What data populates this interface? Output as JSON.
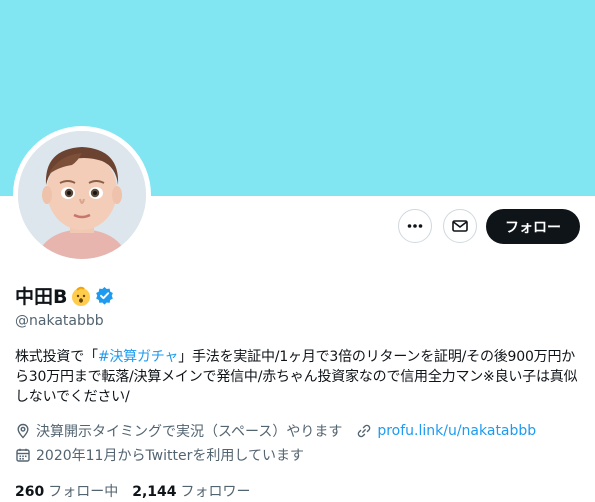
{
  "profile": {
    "display_name": "中田B",
    "handle": "@nakatabbb",
    "name_emoji_icon": "baby-face-emoji",
    "verified_icon": "verified-badge-icon",
    "bio": {
      "part1": "株式投資で「",
      "hashtag": "#決算ガチャ",
      "part2": "」手法を実証中/1ヶ月で3倍のリターンを証明/その後900万円から30万円まで転落/決算メインで発信中/赤ちゃん投資家なので信用全力マン※良い子は真似しないでください/"
    },
    "location": "決算開示タイミングで実況（スペース）やります",
    "website": "profu.link/u/nakatabbb",
    "joined": "2020年11月からTwitterを利用しています",
    "following_count": "260",
    "following_label": "フォロー中",
    "followers_count": "2,144",
    "followers_label": "フォロワー"
  },
  "actions": {
    "more_icon": "more-dots-icon",
    "message_icon": "mail-icon",
    "follow_label": "フォロー"
  },
  "colors": {
    "banner": "#81e6f2",
    "accent": "#1d9bf0",
    "follow_button": "#0f1419",
    "secondary_text": "#536471"
  }
}
